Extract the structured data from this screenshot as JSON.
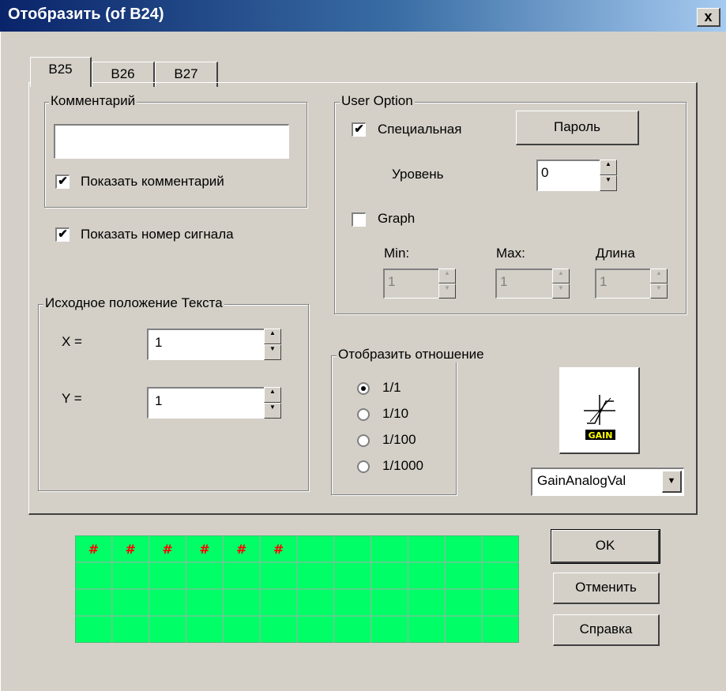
{
  "window": {
    "title": "Отобразить (of B24)",
    "close_glyph": "x"
  },
  "tabs": [
    {
      "label": "B25",
      "active": true
    },
    {
      "label": "B26",
      "active": false
    },
    {
      "label": "B27",
      "active": false
    }
  ],
  "comment_group": {
    "legend": "Комментарий",
    "value": "",
    "show_comment": {
      "label": "Показать комментарий",
      "checked": true
    }
  },
  "show_signal_number": {
    "label": "Показать номер сигнала",
    "checked": true
  },
  "text_position": {
    "legend": "Исходное положение Текста",
    "x_label": "X =",
    "x_value": "1",
    "y_label": "Y =",
    "y_value": "1"
  },
  "user_option": {
    "legend": "User Option",
    "special": {
      "label": "Специальная",
      "checked": true
    },
    "password_button": "Пароль",
    "level": {
      "label": "Уровень",
      "value": "0"
    },
    "graph": {
      "label": "Graph",
      "checked": false
    },
    "min": {
      "label": "Min:",
      "value": "1"
    },
    "max": {
      "label": "Max:",
      "value": "1"
    },
    "length": {
      "label": "Длина",
      "value": "1"
    }
  },
  "ratio": {
    "legend": "Отобразить отношение",
    "options": [
      "1/1",
      "1/10",
      "1/100",
      "1/1000"
    ],
    "selected": "1/1"
  },
  "icon": {
    "name": "gain-icon",
    "text": "GAIN"
  },
  "function_select": {
    "value": "GainAnalogVal"
  },
  "buttons": {
    "ok": "OK",
    "cancel": "Отменить",
    "help": "Справка"
  },
  "preview_grid": {
    "rows": 4,
    "cols": 12,
    "marker": "#",
    "marked_cells": 6,
    "fill_color": "#00ff66",
    "marker_color": "#ff0000"
  }
}
